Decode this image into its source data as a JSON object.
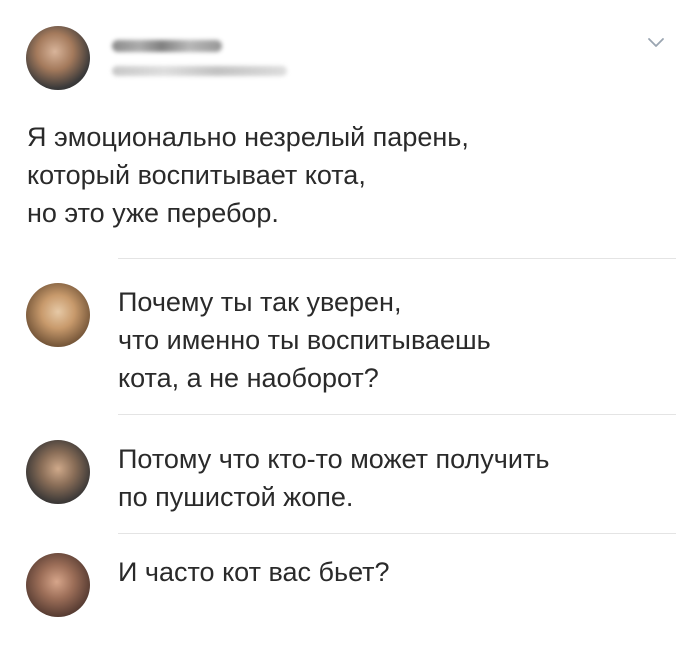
{
  "post": {
    "author_name": "",
    "author_handle": "",
    "text": "Я эмоционально незрелый парень,\nкоторый воспитывает кота,\nно это уже перебор."
  },
  "replies": [
    {
      "text": "Почему ты так уверен,\nчто именно ты воспитываешь\nкота, а не наоборот?"
    },
    {
      "text": "Потому что кто-то может получить\nпо пушистой жопе."
    },
    {
      "text": "И часто кот вас бьет?"
    }
  ],
  "icons": {
    "menu": "chevron-down-icon"
  }
}
